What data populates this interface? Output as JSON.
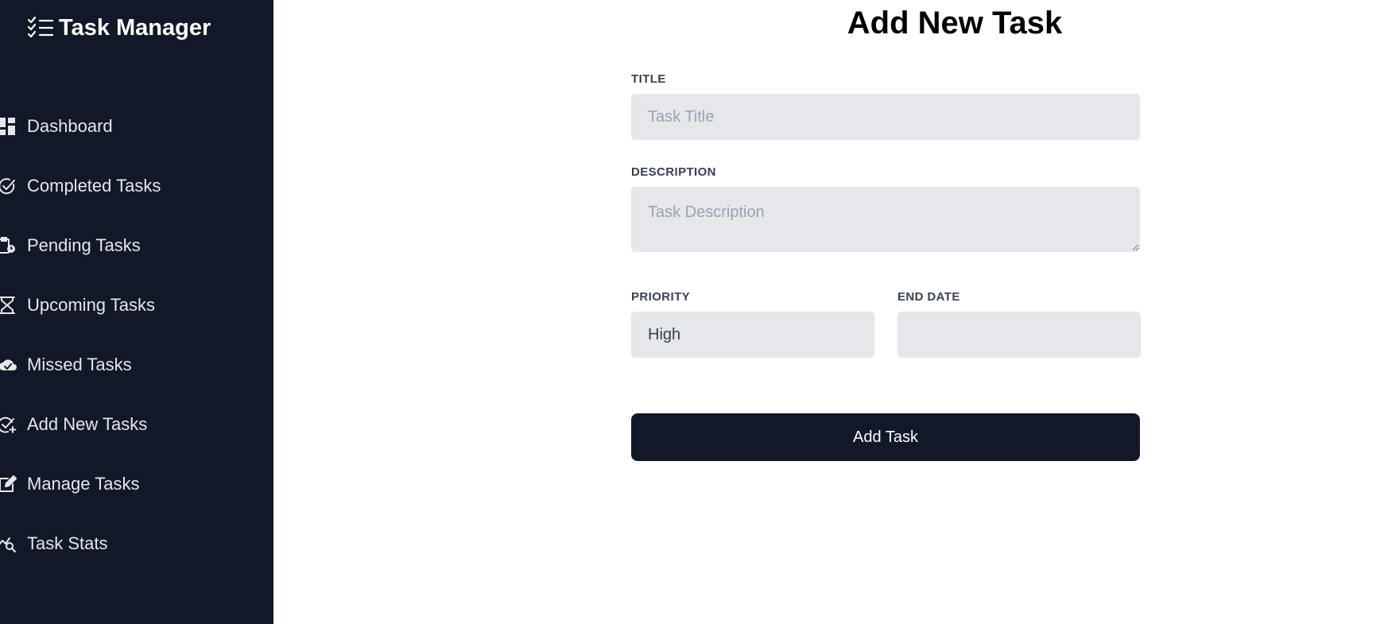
{
  "app": {
    "brand": "Task Manager",
    "brand_icon": "checklist-icon"
  },
  "sidebar": {
    "items": [
      {
        "label": "Dashboard",
        "icon": "dashboard-icon"
      },
      {
        "label": "Completed Tasks",
        "icon": "check-circle-icon"
      },
      {
        "label": "Pending Tasks",
        "icon": "clipboard-clock-icon"
      },
      {
        "label": "Upcoming Tasks",
        "icon": "hourglass-icon"
      },
      {
        "label": "Missed Tasks",
        "icon": "cloud-check-icon"
      },
      {
        "label": "Add New Tasks",
        "icon": "check-plus-icon"
      },
      {
        "label": "Manage Tasks",
        "icon": "edit-icon"
      },
      {
        "label": "Task Stats",
        "icon": "stats-search-icon"
      }
    ]
  },
  "form": {
    "title": "Add New Task",
    "title_label": "TITLE",
    "title_placeholder": "Task Title",
    "description_label": "DESCRIPTION",
    "description_placeholder": "Task Description",
    "priority_label": "PRIORITY",
    "priority_value": "High",
    "end_date_label": "END DATE",
    "end_date_value": "",
    "submit_label": "Add Task"
  },
  "colors": {
    "sidebar_bg": "#111827",
    "input_bg": "#e5e7eb",
    "button_bg": "#111827"
  }
}
